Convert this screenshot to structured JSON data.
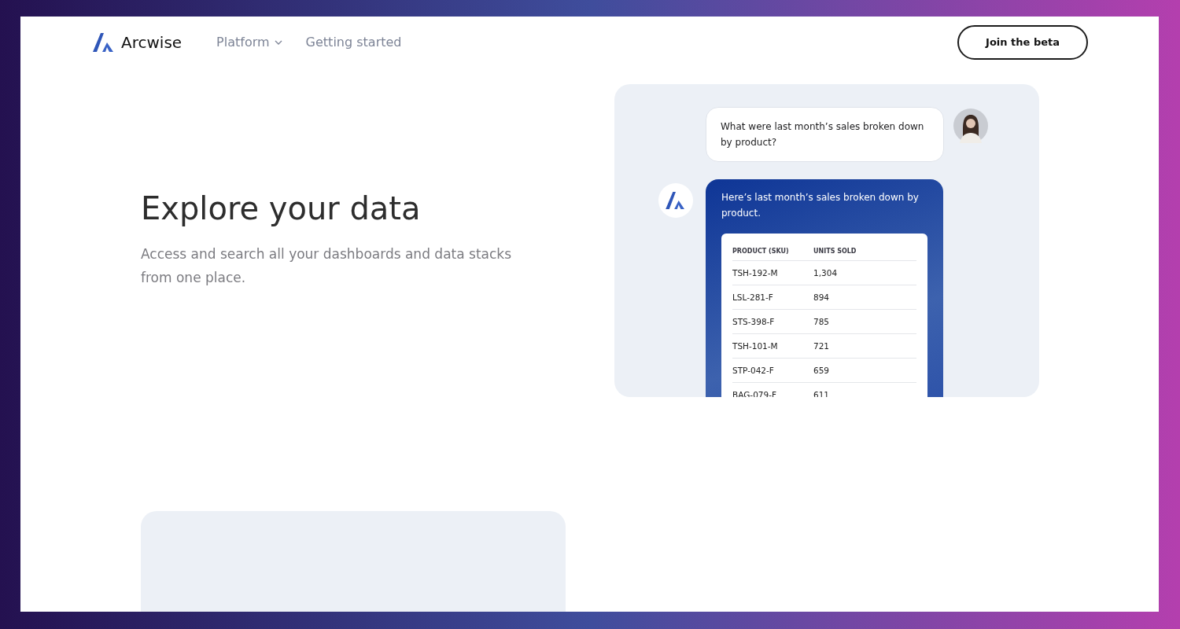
{
  "brand": {
    "name": "Arcwise"
  },
  "nav": [
    {
      "label": "Platform",
      "kind": "dropdown"
    },
    {
      "label": "Getting started",
      "kind": "link"
    }
  ],
  "cta": {
    "label": "Join the beta"
  },
  "hero": {
    "title": "Explore your data",
    "subtitle": "Access and search all your dashboards and data stacks from one place."
  },
  "chat": {
    "question": "What were last month’s sales broken down by product?",
    "answer": "Here’s last month’s sales broken down by product.",
    "table": {
      "columns": [
        "PRODUCT (SKU)",
        "UNITS SOLD"
      ],
      "rows": [
        [
          "TSH-192-M",
          "1,304"
        ],
        [
          "LSL-281-F",
          "894"
        ],
        [
          "STS-398-F",
          "785"
        ],
        [
          "TSH-101-M",
          "721"
        ],
        [
          "STP-042-F",
          "659"
        ],
        [
          "BAG-079-F",
          "611"
        ]
      ]
    }
  }
}
